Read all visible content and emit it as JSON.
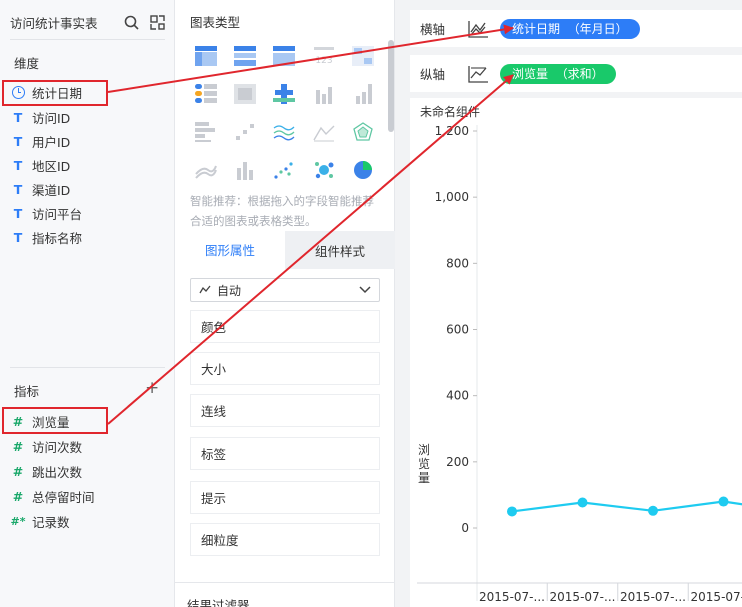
{
  "left": {
    "title": "访问统计事实表",
    "dimensions_title": "维度",
    "dimensions": [
      {
        "type": "date",
        "label": "统计日期"
      },
      {
        "type": "T",
        "label": "访问ID"
      },
      {
        "type": "T",
        "label": "用户ID"
      },
      {
        "type": "T",
        "label": "地区ID"
      },
      {
        "type": "T",
        "label": "渠道ID"
      },
      {
        "type": "T",
        "label": "访问平台"
      },
      {
        "type": "T",
        "label": "指标名称"
      }
    ],
    "measures_title": "指标",
    "measures": [
      {
        "type": "#",
        "label": "浏览量"
      },
      {
        "type": "#",
        "label": "访问次数"
      },
      {
        "type": "#",
        "label": "跳出次数"
      },
      {
        "type": "#",
        "label": "总停留时间"
      },
      {
        "type": "#*",
        "label": "记录数"
      }
    ]
  },
  "middle": {
    "chart_types_title": "图表类型",
    "hint": "智能推荐：根据拖入的字段智能推荐合适的图表或表格类型。",
    "tabs": [
      "图形属性",
      "组件样式"
    ],
    "select_value": "自动",
    "props": [
      "颜色",
      "大小",
      "连线",
      "标签",
      "提示",
      "细粒度"
    ],
    "result_filter": "结果过滤器"
  },
  "right": {
    "x_axis_label": "横轴",
    "x_axis_field": "统计日期  （年月日）",
    "y_axis_label": "纵轴",
    "y_axis_field": "浏览量  （求和）",
    "component_title": "未命名组件",
    "accent_blue": "#2d7df7",
    "accent_green": "#19c96a"
  },
  "chart_data": {
    "type": "line",
    "ylabel": "浏览量",
    "yticks": [
      "1,200",
      "1,000",
      "800",
      "600",
      "400",
      "200",
      "0"
    ],
    "ylim": [
      0,
      1200
    ],
    "categories": [
      "2015-07-...",
      "2015-07-...",
      "2015-07-...",
      "2015-07-..."
    ],
    "values": [
      50,
      77,
      52,
      80
    ],
    "trailing_value": 70,
    "line_color": "#1ecbf0"
  }
}
